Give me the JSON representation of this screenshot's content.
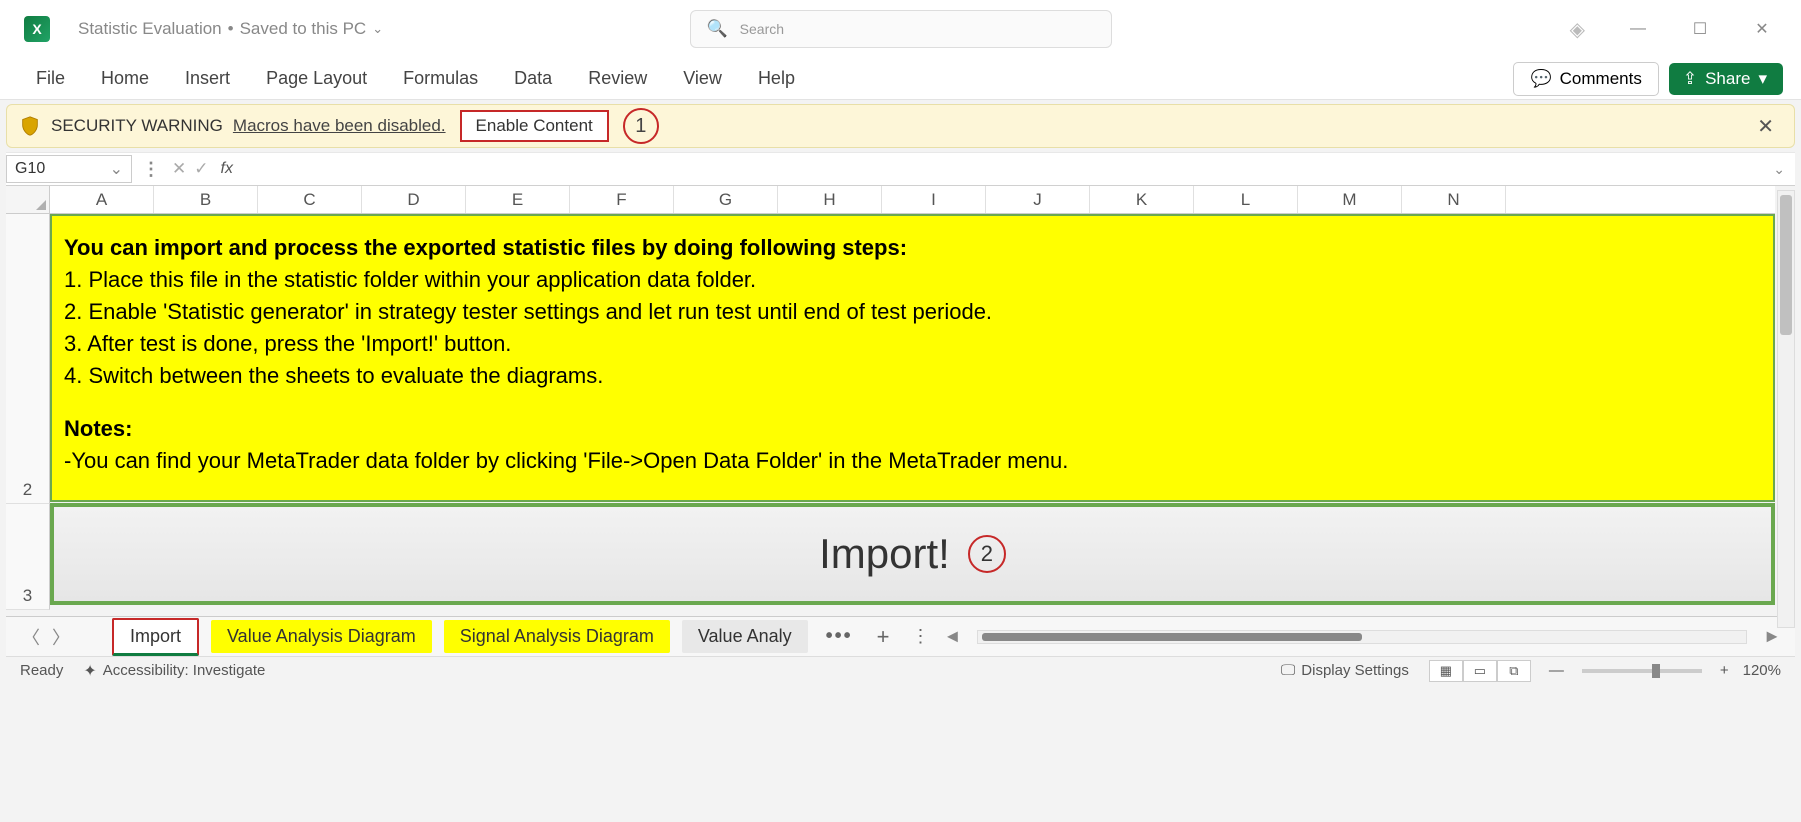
{
  "title": {
    "doc_name": "Statistic Evaluation",
    "save_status": "Saved to this PC",
    "search_placeholder": "Search"
  },
  "ribbon": {
    "tabs": [
      "File",
      "Home",
      "Insert",
      "Page Layout",
      "Formulas",
      "Data",
      "Review",
      "View",
      "Help"
    ],
    "comments_label": "Comments",
    "share_label": "Share"
  },
  "security": {
    "title": "SECURITY WARNING",
    "message": "Macros have been disabled.",
    "enable_label": "Enable Content",
    "annotation": "1"
  },
  "formula_bar": {
    "cell_ref": "G10",
    "fx": "fx",
    "value": ""
  },
  "columns": [
    "A",
    "B",
    "C",
    "D",
    "E",
    "F",
    "G",
    "H",
    "I",
    "J",
    "K",
    "L",
    "M",
    "N"
  ],
  "rows": [
    "2",
    "3"
  ],
  "content": {
    "heading": "You can import and process the exported statistic files by doing following steps:",
    "step1": "1. Place this file in the statistic folder within your application data folder.",
    "step2": "2. Enable 'Statistic generator' in strategy tester settings and let run test until end of test periode.",
    "step3": "3. After test is done, press the 'Import!' button.",
    "step4": "4. Switch between the sheets to evaluate the diagrams.",
    "notes_label": "Notes:",
    "note1": "-You can find your MetaTrader data folder by clicking 'File->Open Data Folder' in the MetaTrader menu.",
    "import_button": "Import!",
    "annotation2": "2"
  },
  "sheets": {
    "active": "Import",
    "tab2": "Value Analysis Diagram",
    "tab3": "Signal Analysis Diagram",
    "tab4": "Value Analy"
  },
  "status": {
    "ready": "Ready",
    "accessibility": "Accessibility: Investigate",
    "display_settings": "Display Settings",
    "zoom": "120%"
  }
}
